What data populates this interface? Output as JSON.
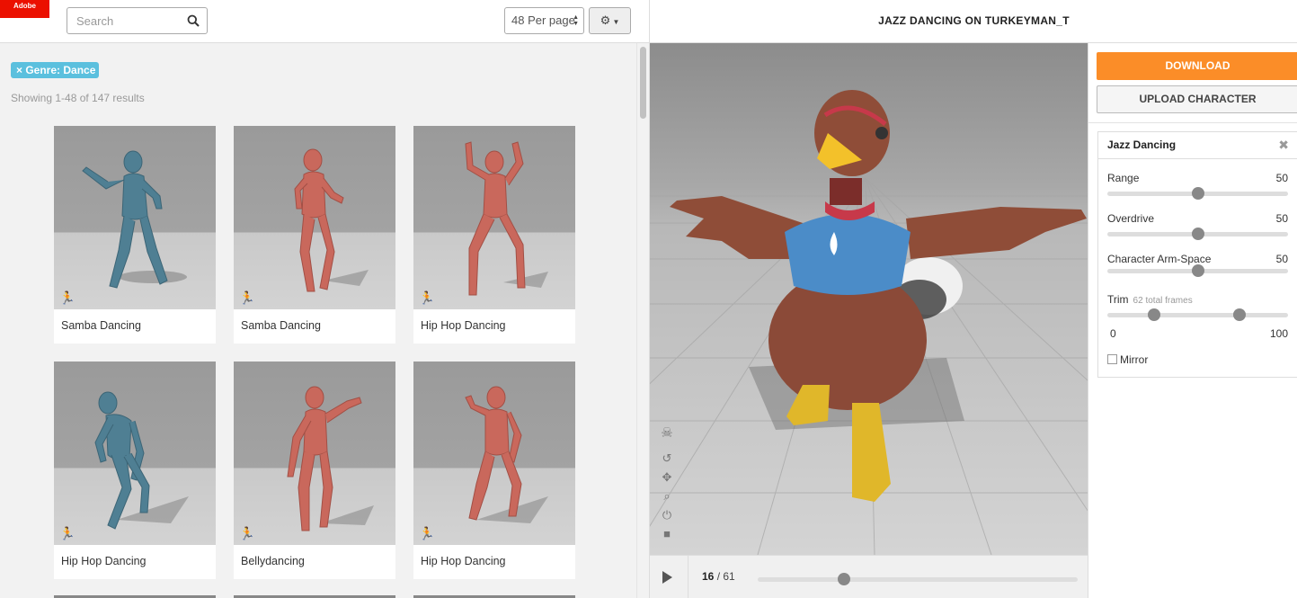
{
  "header": {
    "logo_text": "Adobe",
    "search_placeholder": "Search",
    "per_page": "48 Per page"
  },
  "filter": {
    "tag": "× Genre: Dance",
    "results": "Showing 1-48 of 147 results"
  },
  "cards": [
    {
      "title": "Samba Dancing",
      "color": "#4f7f93"
    },
    {
      "title": "Samba Dancing",
      "color": "#c9685c"
    },
    {
      "title": "Hip Hop Dancing",
      "color": "#c9685c"
    },
    {
      "title": "Hip Hop Dancing",
      "color": "#4f7f93"
    },
    {
      "title": "Bellydancing",
      "color": "#c9685c"
    },
    {
      "title": "Hip Hop Dancing",
      "color": "#c9685c"
    }
  ],
  "viewer": {
    "title": "JAZZ DANCING ON TURKEYMAN_T",
    "current_frame": "16",
    "frame_sep": " / ",
    "total_frames": "61",
    "progress": 0.27
  },
  "sidebar": {
    "download_label": "DOWNLOAD",
    "upload_label": "UPLOAD CHARACTER",
    "panel_title": "Jazz Dancing",
    "range": {
      "label": "Range",
      "value": "50",
      "fraction": 0.5
    },
    "overdrive": {
      "label": "Overdrive",
      "value": "50",
      "fraction": 0.5
    },
    "arm_space": {
      "label": "Character Arm-Space",
      "value": "50",
      "fraction": 0.5
    },
    "trim": {
      "label": "Trim",
      "sub": "62 total frames",
      "min": "0",
      "max": "100",
      "low": 0.26,
      "high": 0.73
    },
    "mirror_label": "Mirror"
  },
  "colors": {
    "accent": "#fb8d28",
    "tag": "#5bc0de",
    "brand": "#eb1000"
  }
}
